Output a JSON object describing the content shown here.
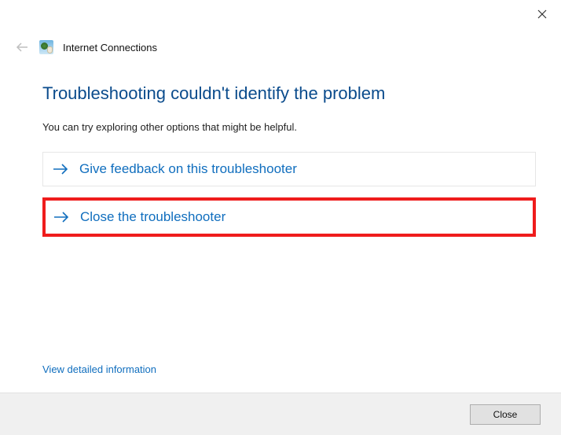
{
  "window": {
    "title": "Internet Connections"
  },
  "main": {
    "heading": "Troubleshooting couldn't identify the problem",
    "subtext": "You can try exploring other options that might be helpful."
  },
  "options": {
    "feedback": "Give feedback on this troubleshooter",
    "close": "Close the troubleshooter"
  },
  "links": {
    "detailed": "View detailed information"
  },
  "footer": {
    "close_label": "Close"
  },
  "colors": {
    "accent": "#106ebe",
    "heading": "#0a4b8c",
    "highlight_border": "#ef1c1c"
  }
}
